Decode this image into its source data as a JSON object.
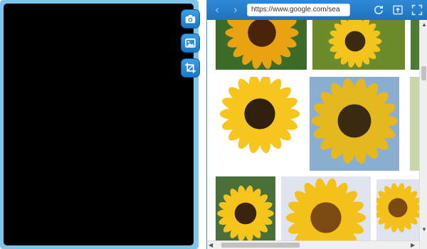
{
  "browser": {
    "url": "https://www.google.com/sea",
    "nav_back_glyph": "‹",
    "nav_forward_glyph": "›"
  },
  "colors": {
    "frame_blue": "#7fc4ec",
    "toolbar_blue": "#1f72bf",
    "petal_yellow": "#f2c318",
    "center_brown": "#3b2410"
  },
  "icons": {
    "camera": "camera-icon",
    "image": "image-icon",
    "crop": "crop-icon",
    "refresh": "refresh-icon",
    "upload": "upload-icon",
    "fullscreen": "fullscreen-icon"
  },
  "results": [
    {
      "name": "sunflower-result-1",
      "bg": "#3c6b2a",
      "petal": "#e9a310",
      "center": "#4a2408"
    },
    {
      "name": "sunflower-result-2",
      "bg": "#6b8b2c",
      "petal": "#f3c51c",
      "center": "#3a2a10"
    },
    {
      "name": "sunflower-result-3",
      "bg": "#4f7a36",
      "petal": "#f0c41a",
      "center": "#3d2a12"
    },
    {
      "name": "sunflower-result-4",
      "bg": "#ffffff",
      "petal": "#f6c61e",
      "center": "#2f1f0d"
    },
    {
      "name": "sunflower-result-5",
      "bg": "#89aed2",
      "petal": "#e6b820",
      "center": "#3a2a12"
    },
    {
      "name": "sunflower-result-6",
      "bg": "#c8d6a8",
      "petal": "#8e2436",
      "center": "#2b1a10"
    },
    {
      "name": "sunflower-result-7",
      "bg": "#4a6f38",
      "petal": "#f5c51c",
      "center": "#3a2410"
    },
    {
      "name": "sunflower-result-8",
      "bg": "#dfe4ef",
      "petal": "#f4c01a",
      "center": "#7a4a12"
    }
  ]
}
